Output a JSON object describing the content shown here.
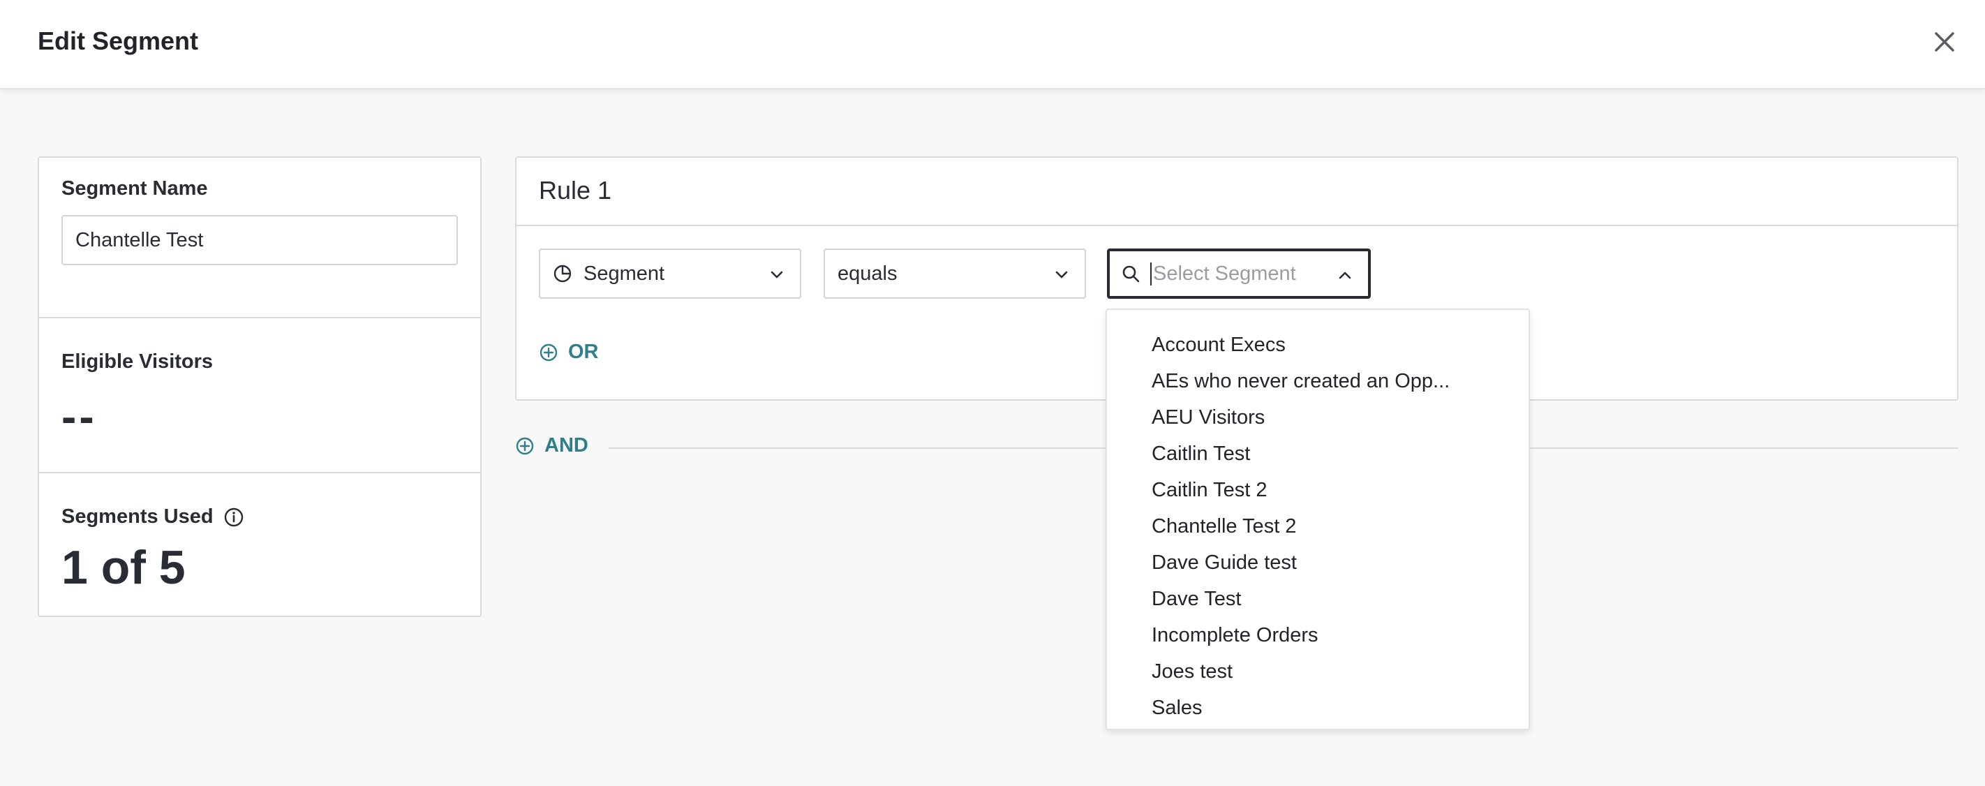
{
  "header": {
    "title": "Edit Segment"
  },
  "left_panel": {
    "segment_name_label": "Segment Name",
    "segment_name_value": "Chantelle Test",
    "eligible_visitors_label": "Eligible Visitors",
    "eligible_visitors_value": "--",
    "segments_used_label": "Segments Used",
    "segments_used_value": "1 of 5"
  },
  "rule": {
    "title": "Rule 1",
    "field_select": "Segment",
    "operator_select": "equals",
    "value_placeholder": "Select Segment",
    "or_label": "OR"
  },
  "and_label": "AND",
  "dropdown": {
    "options": [
      "Account Execs",
      "AEs who never created an Opp...",
      "AEU Visitors",
      "Caitlin Test",
      "Caitlin Test 2",
      "Chantelle Test 2",
      "Dave Guide test",
      "Dave Test",
      "Incomplete Orders",
      "Joes test",
      "Sales"
    ]
  },
  "colors": {
    "accent": "#2f7f8a",
    "text": "#2a2c35",
    "border": "#dadada"
  },
  "icons": {
    "close": "close-icon",
    "info": "info-icon",
    "segment": "pie-chart-icon",
    "chevron_down": "chevron-down-icon",
    "chevron_up": "chevron-up-icon",
    "search": "search-icon",
    "add": "plus-circle-icon"
  }
}
